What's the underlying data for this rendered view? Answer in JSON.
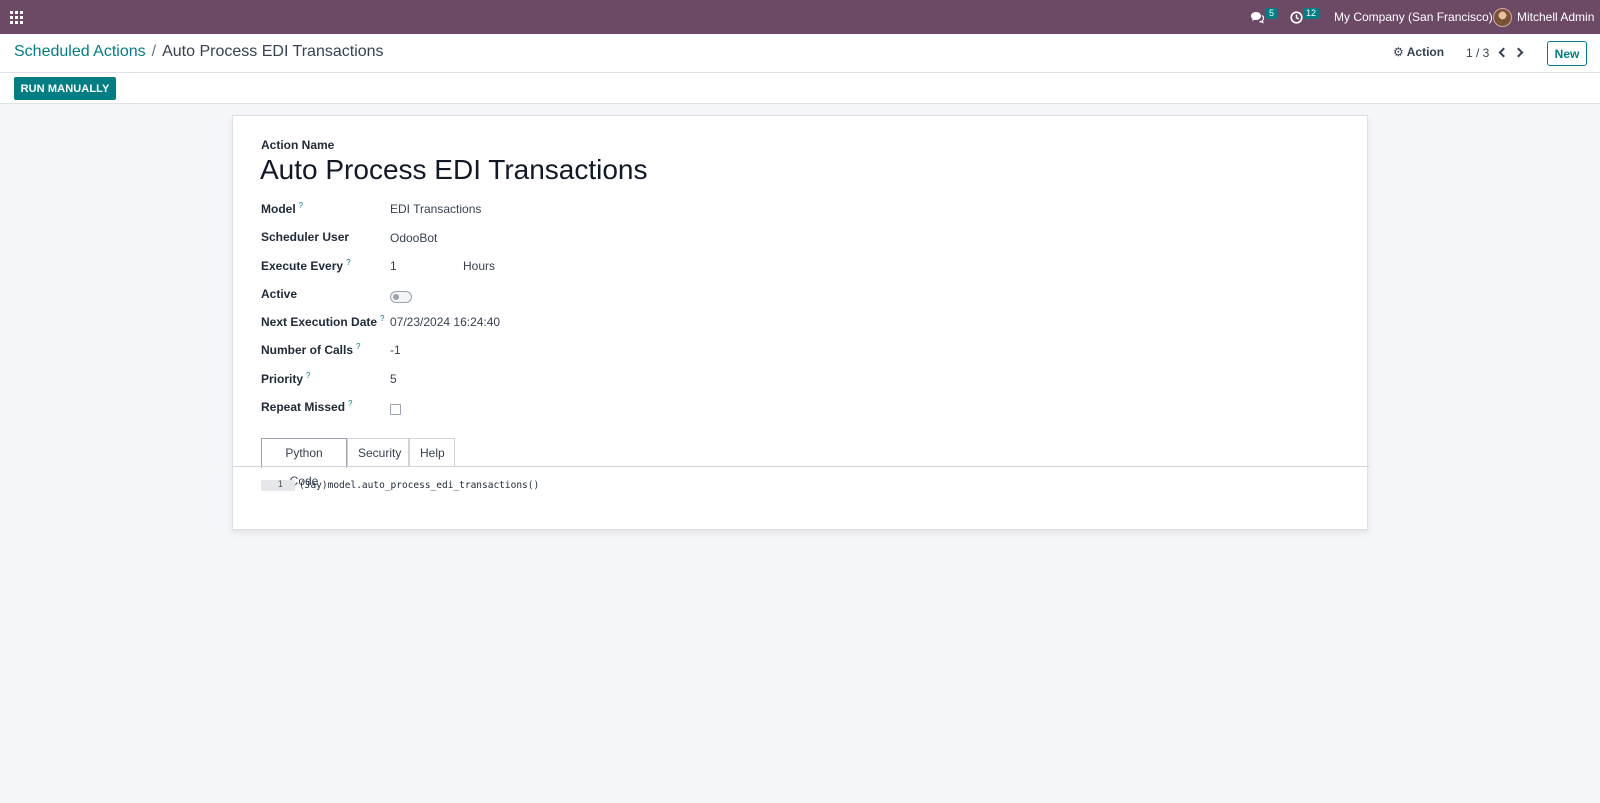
{
  "navbar": {
    "chat_count": "5",
    "activity_count": "12",
    "company": "My Company (San Francisco)",
    "user": "Mitchell Admin"
  },
  "control_panel": {
    "breadcrumb_parent": "Scheduled Actions",
    "breadcrumb_separator": "/",
    "breadcrumb_current": "Auto Process EDI Transactions",
    "action_label": "Action",
    "pager": "1 / 3",
    "new_label": "New",
    "run_manually_label": "RUN MANUALLY"
  },
  "form": {
    "name_label": "Action Name",
    "name_value": "Auto Process EDI Transactions",
    "fields": {
      "model_label": "Model",
      "model_value": "EDI Transactions",
      "scheduler_user_label": "Scheduler User",
      "scheduler_user_value": "OdooBot",
      "execute_every_label": "Execute Every",
      "execute_every_value": "1",
      "execute_every_unit": "Hours",
      "active_label": "Active",
      "active_value": false,
      "next_exec_label": "Next Execution Date",
      "next_exec_value": "07/23/2024 16:24:40",
      "number_calls_label": "Number of Calls",
      "number_calls_value": "-1",
      "priority_label": "Priority",
      "priority_value": "5",
      "repeat_missed_label": "Repeat Missed",
      "repeat_missed_value": false,
      "help_marker": "?"
    },
    "tabs": [
      "Python Code",
      "Security",
      "Help"
    ],
    "active_tab": "Python Code",
    "code": {
      "line_number": "1",
      "line_text": "(Jay)model.auto_process_edi_transactions()"
    }
  },
  "colors": {
    "navbar": "#6c4a66",
    "accent": "#017e84",
    "background": "#f5f6fa"
  },
  "icons": [
    "apps-grid-icon",
    "chat-icon",
    "clock-icon",
    "gear-icon",
    "chevron-left-icon",
    "chevron-right-icon"
  ]
}
